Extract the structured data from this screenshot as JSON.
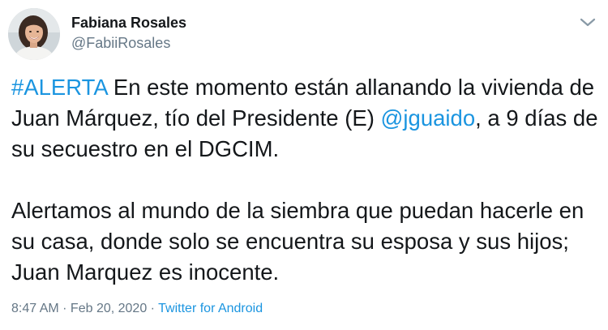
{
  "author": {
    "name": "Fabiana Rosales",
    "handle": "@FabiiRosales",
    "avatar_icon": "profile-photo"
  },
  "menu_icon": "chevron-down-icon",
  "tweet": {
    "paragraph1": {
      "hashtag": "#ALERTA",
      "text_a": " En este momento están allanando la vivienda de Juan Márquez, tío del Presidente (E) ",
      "mention": "@jguaido",
      "text_b": ", a 9 días de su secuestro en el DGCIM."
    },
    "paragraph2": "Alertamos al mundo de la siembra que puedan hacerle en su casa, donde solo se encuentra su esposa y sus hijos; Juan Marquez es inocente."
  },
  "meta": {
    "time": "8:47 AM",
    "separator1": " · ",
    "date": "Feb 20, 2020",
    "separator2": " · ",
    "source": "Twitter for Android"
  },
  "colors": {
    "link": "#1b95e0",
    "secondary_text": "#657786",
    "primary_text": "#14171a"
  }
}
